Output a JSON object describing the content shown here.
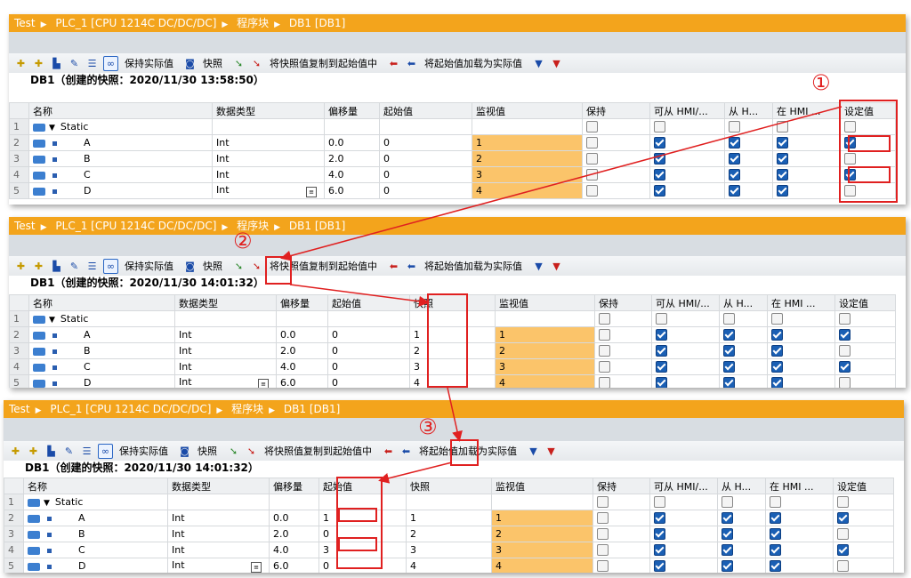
{
  "panel1": {
    "breadcrumb": [
      "Test",
      "PLC_1 [CPU 1214C DC/DC/DC]",
      "程序块",
      "DB1 [DB1]"
    ],
    "db_title": "DB1（创建的快照：2020/11/30 13:58:50）",
    "headers": [
      "",
      "名称",
      "数据类型",
      "偏移量",
      "起始值",
      "监视值",
      "保持",
      "可从 HMI/...",
      "从 H...",
      "在 HMI ...",
      "设定值"
    ],
    "rows": [
      {
        "n": "1",
        "name": "Static",
        "type": "",
        "offset": "",
        "start": "",
        "monitor": "",
        "keep": false,
        "hmi1": false,
        "hmi2": false,
        "hmi3": false,
        "set": false
      },
      {
        "n": "2",
        "name": "A",
        "type": "Int",
        "offset": "0.0",
        "start": "0",
        "monitor": "1",
        "keep": false,
        "hmi1": true,
        "hmi2": true,
        "hmi3": true,
        "set": true
      },
      {
        "n": "3",
        "name": "B",
        "type": "Int",
        "offset": "2.0",
        "start": "0",
        "monitor": "2",
        "keep": false,
        "hmi1": true,
        "hmi2": true,
        "hmi3": true,
        "set": false
      },
      {
        "n": "4",
        "name": "C",
        "type": "Int",
        "offset": "4.0",
        "start": "0",
        "monitor": "3",
        "keep": false,
        "hmi1": true,
        "hmi2": true,
        "hmi3": true,
        "set": true
      },
      {
        "n": "5",
        "name": "D",
        "type": "Int",
        "offset": "6.0",
        "start": "0",
        "monitor": "4",
        "keep": false,
        "hmi1": true,
        "hmi2": true,
        "hmi3": true,
        "set": false
      }
    ]
  },
  "panel2": {
    "breadcrumb": [
      "Test",
      "PLC_1 [CPU 1214C DC/DC/DC]",
      "程序块",
      "DB1 [DB1]"
    ],
    "db_title": "DB1（创建的快照：2020/11/30 14:01:32）",
    "headers": [
      "",
      "名称",
      "数据类型",
      "偏移量",
      "起始值",
      "快照",
      "监视值",
      "保持",
      "可从 HMI/...",
      "从 H...",
      "在 HMI ...",
      "设定值"
    ],
    "rows": [
      {
        "n": "1",
        "name": "Static",
        "type": "",
        "offset": "",
        "start": "",
        "snap": "",
        "monitor": "",
        "keep": false,
        "hmi1": false,
        "hmi2": false,
        "hmi3": false,
        "set": false
      },
      {
        "n": "2",
        "name": "A",
        "type": "Int",
        "offset": "0.0",
        "start": "0",
        "snap": "1",
        "monitor": "1",
        "keep": false,
        "hmi1": true,
        "hmi2": true,
        "hmi3": true,
        "set": true
      },
      {
        "n": "3",
        "name": "B",
        "type": "Int",
        "offset": "2.0",
        "start": "0",
        "snap": "2",
        "monitor": "2",
        "keep": false,
        "hmi1": true,
        "hmi2": true,
        "hmi3": true,
        "set": false
      },
      {
        "n": "4",
        "name": "C",
        "type": "Int",
        "offset": "4.0",
        "start": "0",
        "snap": "3",
        "monitor": "3",
        "keep": false,
        "hmi1": true,
        "hmi2": true,
        "hmi3": true,
        "set": true
      },
      {
        "n": "5",
        "name": "D",
        "type": "Int",
        "offset": "6.0",
        "start": "0",
        "snap": "4",
        "monitor": "4",
        "keep": false,
        "hmi1": true,
        "hmi2": true,
        "hmi3": true,
        "set": false
      }
    ]
  },
  "panel3": {
    "breadcrumb": [
      "Test",
      "PLC_1 [CPU 1214C DC/DC/DC]",
      "程序块",
      "DB1 [DB1]"
    ],
    "db_title": "DB1（创建的快照：2020/11/30 14:01:32）",
    "headers": [
      "",
      "名称",
      "数据类型",
      "偏移量",
      "起始值",
      "快照",
      "监视值",
      "保持",
      "可从 HMI/...",
      "从 H...",
      "在 HMI ...",
      "设定值"
    ],
    "rows": [
      {
        "n": "1",
        "name": "Static",
        "type": "",
        "offset": "",
        "start": "",
        "snap": "",
        "monitor": "",
        "keep": false,
        "hmi1": false,
        "hmi2": false,
        "hmi3": false,
        "set": false
      },
      {
        "n": "2",
        "name": "A",
        "type": "Int",
        "offset": "0.0",
        "start": "1",
        "snap": "1",
        "monitor": "1",
        "keep": false,
        "hmi1": true,
        "hmi2": true,
        "hmi3": true,
        "set": true
      },
      {
        "n": "3",
        "name": "B",
        "type": "Int",
        "offset": "2.0",
        "start": "0",
        "snap": "2",
        "monitor": "2",
        "keep": false,
        "hmi1": true,
        "hmi2": true,
        "hmi3": true,
        "set": false
      },
      {
        "n": "4",
        "name": "C",
        "type": "Int",
        "offset": "4.0",
        "start": "3",
        "snap": "3",
        "monitor": "3",
        "keep": false,
        "hmi1": true,
        "hmi2": true,
        "hmi3": true,
        "set": true
      },
      {
        "n": "5",
        "name": "D",
        "type": "Int",
        "offset": "6.0",
        "start": "0",
        "snap": "4",
        "monitor": "4",
        "keep": false,
        "hmi1": true,
        "hmi2": true,
        "hmi3": true,
        "set": false
      }
    ]
  },
  "toolbar": {
    "keep_actual": "保持实际值",
    "snapshot": "快照",
    "copy_snapshot": "将快照值复制到起始值中",
    "load_start": "将起始值加载为实际值"
  },
  "annotations": {
    "step1": "①",
    "step2": "②",
    "step3": "③"
  },
  "colors": {
    "breadcrumb": "#f3a41c",
    "monitor_highlight": "#fbc46a",
    "callout": "#e02020",
    "checkbox_on": "#1a5fb4"
  }
}
